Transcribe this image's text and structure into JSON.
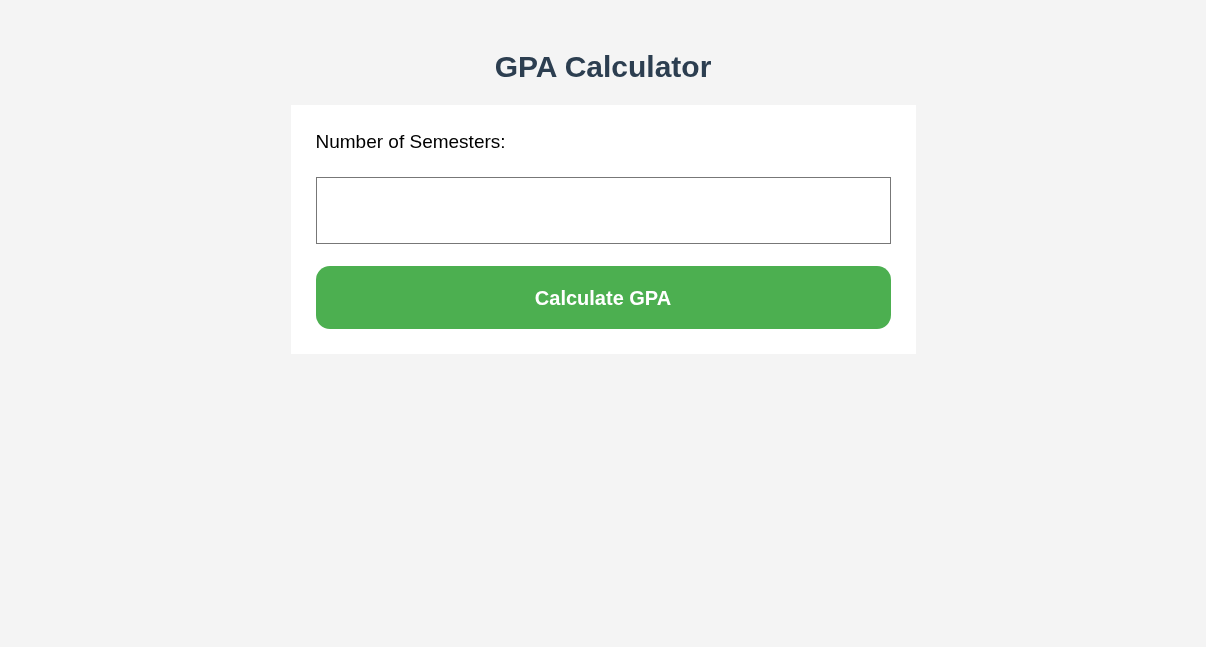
{
  "title": "GPA Calculator",
  "form": {
    "label": "Number of Semesters:",
    "button": "Calculate GPA"
  }
}
